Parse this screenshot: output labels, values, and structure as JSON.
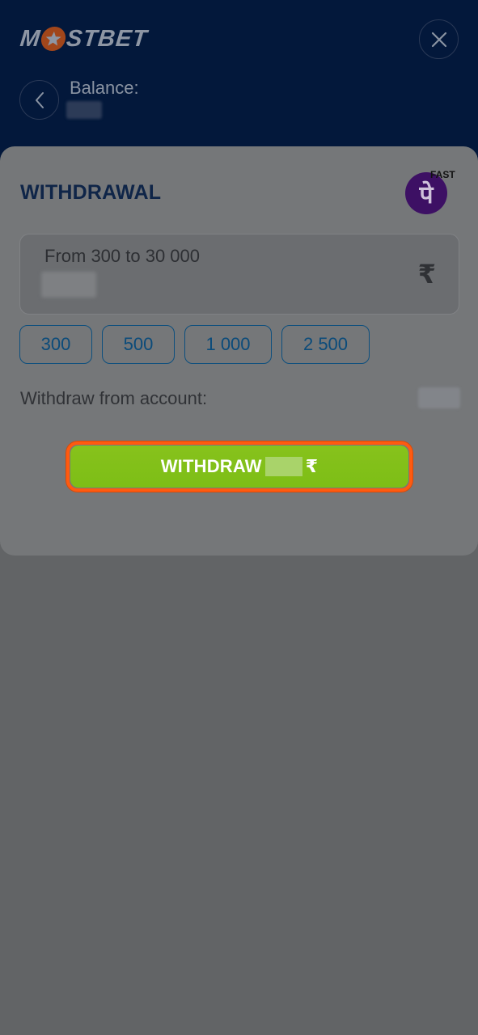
{
  "header": {
    "logo_text_left": "M",
    "logo_text_right": "STBET",
    "balance_label": "Balance:",
    "balance_value": "",
    "colors": {
      "background": "#03183b",
      "logo_star": "#a1461b"
    }
  },
  "withdrawal": {
    "title": "WITHDRAWAL",
    "method": {
      "logo_glyph": "पे",
      "badge": "FAST",
      "icon": "phonepe-logo"
    },
    "amount_field": {
      "placeholder": "From 300 to 30 000",
      "value": "",
      "currency_symbol": "₹"
    },
    "quick_amounts": [
      "300",
      "500",
      "1 000",
      "2 500"
    ],
    "withdraw_from_label": "Withdraw from account:",
    "withdraw_from_value": "",
    "submit": {
      "label": "WITHDRAW",
      "amount": "",
      "currency_symbol": "₹"
    },
    "colors": {
      "submit": "#7dbe16",
      "highlight": "#ff5a10",
      "chip_border": "#0d4f7e"
    }
  }
}
